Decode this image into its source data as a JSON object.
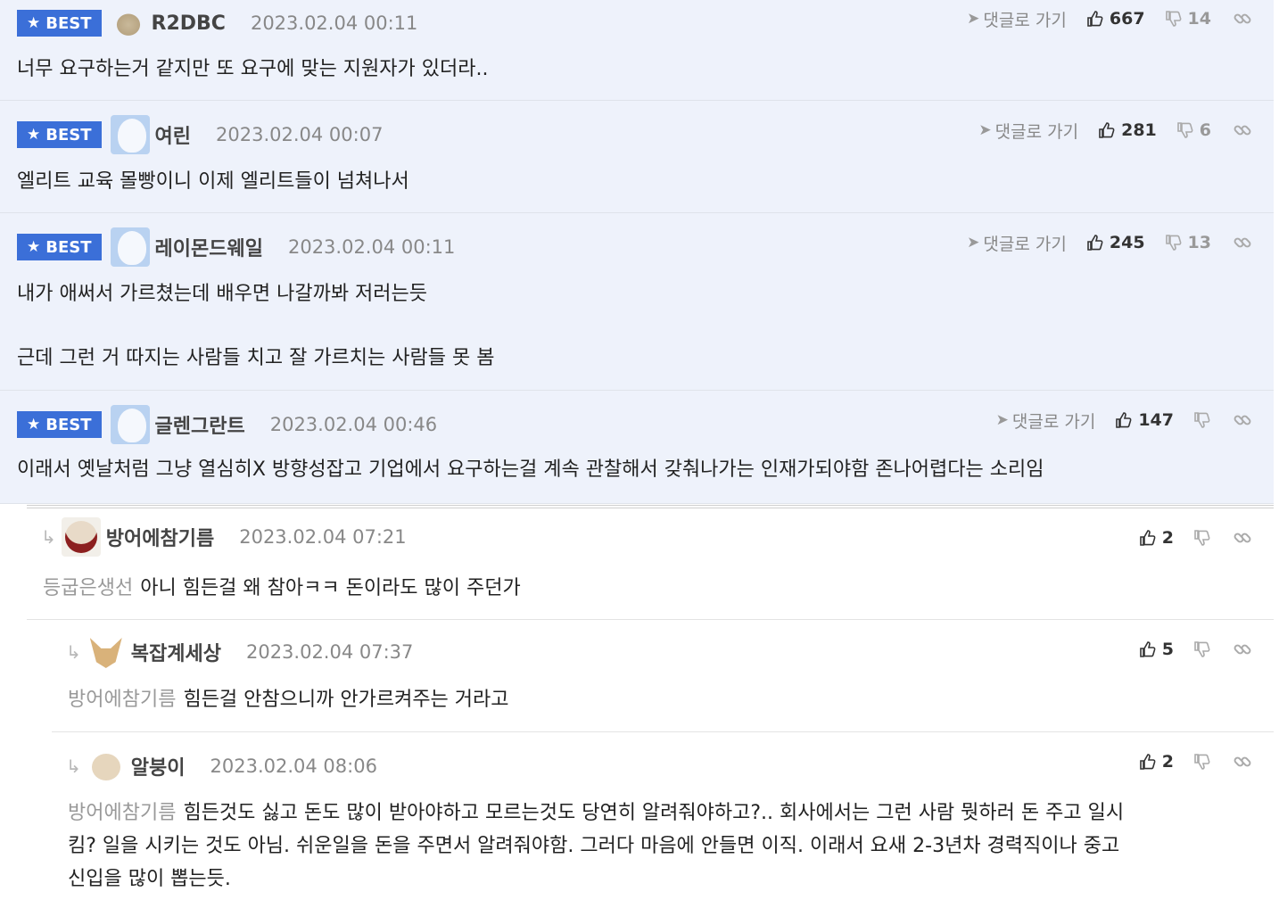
{
  "ui": {
    "best_label": "BEST",
    "goto_label": "댓글로 가기"
  },
  "comments": [
    {
      "nick": "R2DBC",
      "date": "2023.02.04 00:11",
      "up": "667",
      "down": "14",
      "text": "너무 요구하는거 같지만 또 요구에 맞는 지원자가 있더라.."
    },
    {
      "nick": "여린",
      "date": "2023.02.04 00:07",
      "up": "281",
      "down": "6",
      "text": "엘리트 교육 몰빵이니 이제 엘리트들이 넘쳐나서"
    },
    {
      "nick": "레이몬드웨일",
      "date": "2023.02.04 00:11",
      "up": "245",
      "down": "13",
      "text_line1": "내가 애써서 가르쳤는데 배우면 나갈까봐 저러는듯",
      "text_line2": "근데 그런 거 따지는 사람들 치고 잘 가르치는 사람들 못 봄"
    },
    {
      "nick": "글렌그란트",
      "date": "2023.02.04 00:46",
      "up": "147",
      "text": "이래서 옛날처럼 그냥 열심히X 방향성잡고 기업에서 요구하는걸 계속 관찰해서 갖춰나가는 인재가되야함 존나어렵다는 소리임"
    }
  ],
  "replies": [
    {
      "nick": "방어에참기름",
      "date": "2023.02.04 07:21",
      "up": "2",
      "mention": "등굽은생선",
      "text": "아니 힘든걸 왜 참아ㅋㅋ 돈이라도 많이 주던가"
    },
    {
      "nick": "복잡계세상",
      "date": "2023.02.04 07:37",
      "up": "5",
      "mention": "방어에참기름",
      "text": "힘든걸 안참으니까 안가르켜주는 거라고"
    },
    {
      "nick": "알붕이",
      "date": "2023.02.04 08:06",
      "up": "2",
      "mention": "방어에참기름",
      "text_line1": "힘든것도 싫고 돈도 많이 받아야하고 모르는것도 당연히 알려줘야하고?.. 회사에서는 그런 사람 뭣하러 돈 주고 일시",
      "text_line2": "킴? 일을 시키는 것도 아님. 쉬운일을 돈을 주면서 알려줘야함. 그러다 마음에 안들면 이직. 이래서 요새 2-3년차 경력직이나 중고",
      "text_line3": "신입을 많이 뽑는듯."
    }
  ]
}
